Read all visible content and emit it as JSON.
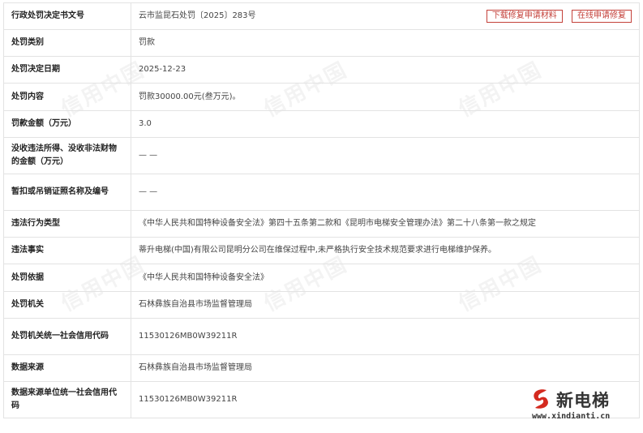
{
  "rows": [
    {
      "label": "行政处罚决定书文号",
      "value": "云市监昆石处罚〔2025〕283号"
    },
    {
      "label": "处罚类别",
      "value": "罚款"
    },
    {
      "label": "处罚决定日期",
      "value": "2025-12-23"
    },
    {
      "label": "处罚内容",
      "value": "罚款30000.00元(叁万元)。"
    },
    {
      "label": "罚款金额（万元）",
      "value": "3.0"
    },
    {
      "label": "没收违法所得、没收非法财物的金额（万元）",
      "value": "— —"
    },
    {
      "label": "暂扣或吊销证照名称及编号",
      "value": "— —"
    },
    {
      "label": "违法行为类型",
      "value": "《中华人民共和国特种设备安全法》第四十五条第二款和《昆明市电梯安全管理办法》第二十八条第一款之规定"
    },
    {
      "label": "违法事实",
      "value": "蒂升电梯(中国)有限公司昆明分公司在维保过程中,未严格执行安全技术规范要求进行电梯维护保养。"
    },
    {
      "label": "处罚依据",
      "value": "《中华人民共和国特种设备安全法》"
    },
    {
      "label": "处罚机关",
      "value": "石林彝族自治县市场监督管理局"
    },
    {
      "label": "处罚机关统一社会信用代码",
      "value": "11530126MB0W39211R"
    },
    {
      "label": "数据来源",
      "value": "石林彝族自治县市场监督管理局"
    },
    {
      "label": "数据来源单位统一社会信用代码",
      "value": "11530126MB0W39211R"
    }
  ],
  "buttons": {
    "download": "下载修复申请材料",
    "apply": "在线申请修复"
  },
  "watermark": "信用中国",
  "logo": {
    "name": "新电梯",
    "url": "www.xindianti.cn"
  },
  "colors": {
    "accent": "#c4413a",
    "border": "#e3e3e3"
  }
}
